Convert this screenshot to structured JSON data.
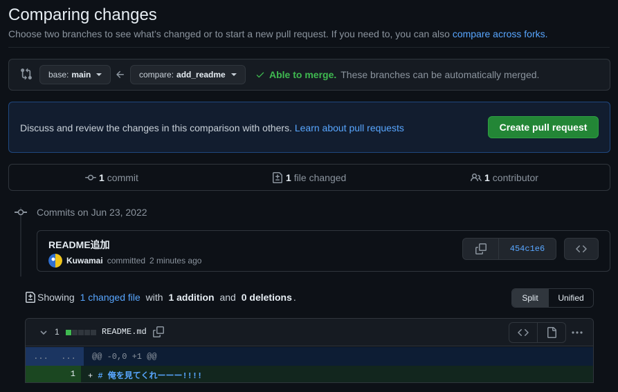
{
  "header": {
    "title": "Comparing changes",
    "description": "Choose two branches to see what’s changed or to start a new pull request. If you need to, you can also",
    "forks_link": "compare across forks."
  },
  "range": {
    "base_key": "base:",
    "base_value": "main",
    "compare_key": "compare:",
    "compare_value": "add_readme",
    "merge_ok": "Able to merge.",
    "merge_desc": "These branches can be automatically merged."
  },
  "banner": {
    "text": "Discuss and review the changes in this comparison with others.",
    "link": "Learn about pull requests",
    "button": "Create pull request"
  },
  "stats": {
    "commits_count": "1",
    "commits_label": "commit",
    "files_count": "1",
    "files_label": "file changed",
    "contributors_count": "1",
    "contributors_label": "contributor"
  },
  "commits": {
    "date_header": "Commits on Jun 23, 2022",
    "items": [
      {
        "title": "README追加",
        "author": "Kuwamai",
        "action": "committed",
        "time": "2 minutes ago",
        "sha": "454c1e6"
      }
    ]
  },
  "summary": {
    "prefix": "Showing",
    "changed_link": "1 changed file",
    "with": "with",
    "additions": "1 addition",
    "and": "and",
    "deletions": "0 deletions",
    "suffix": "."
  },
  "view_toggle": {
    "split": "Split",
    "unified": "Unified"
  },
  "diff": {
    "count": "1",
    "file_name": "README.md",
    "hunk_old": "...",
    "hunk_new": "...",
    "hunk_header": "@@ -0,0 +1 @@",
    "add_line_number": "1",
    "add_marker": "+",
    "add_content": "# 俺を見てくれーーー!!!!"
  },
  "colors": {
    "accent": "#58a6ff",
    "success": "#3fb950",
    "button_green": "#238636"
  }
}
